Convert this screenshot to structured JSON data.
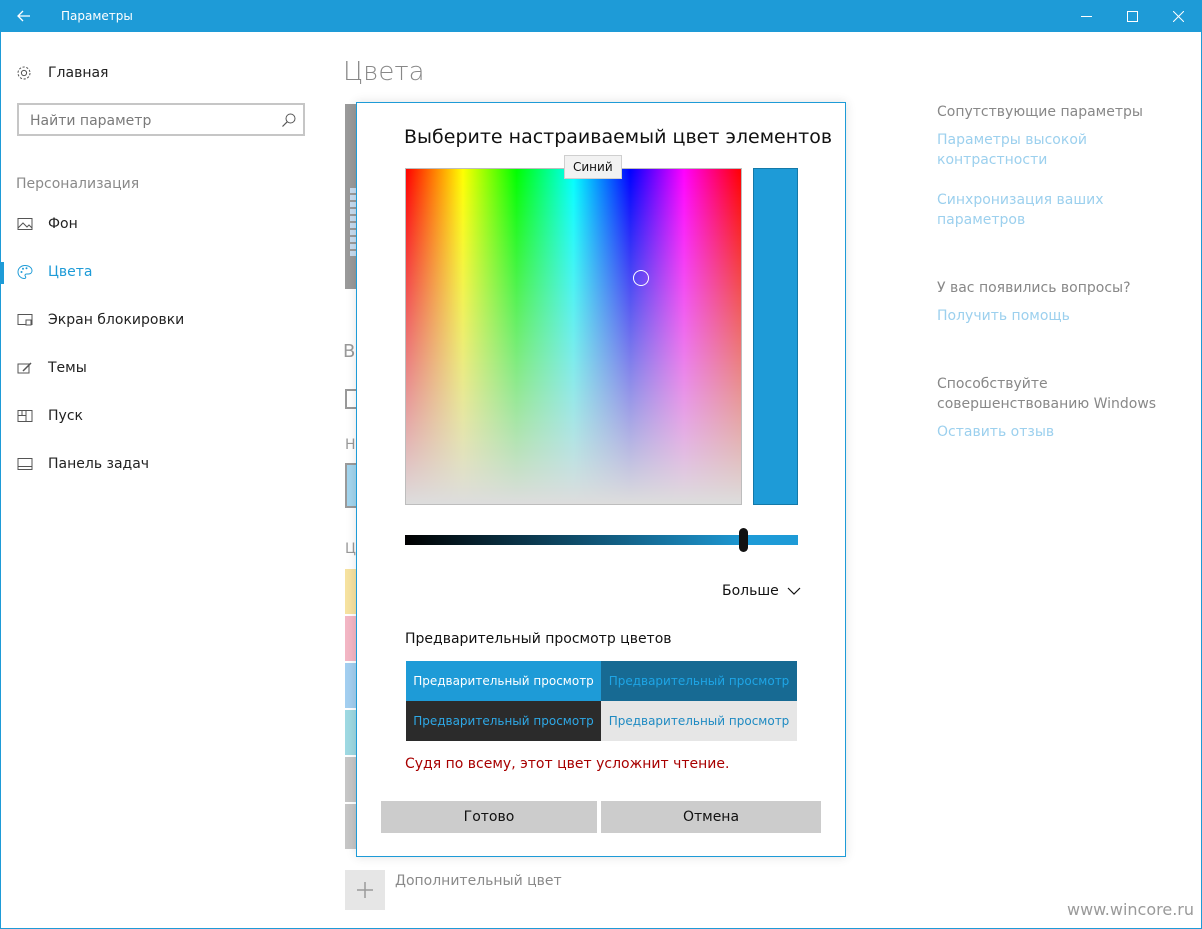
{
  "window": {
    "title": "Параметры"
  },
  "sidebar": {
    "home_label": "Главная",
    "search_placeholder": "Найти параметр",
    "section_label": "Персонализация",
    "items": [
      {
        "label": "Фон",
        "icon": "image-icon"
      },
      {
        "label": "Цвета",
        "icon": "palette-icon",
        "active": true
      },
      {
        "label": "Экран блокировки",
        "icon": "lock-screen-icon"
      },
      {
        "label": "Темы",
        "icon": "themes-icon"
      },
      {
        "label": "Пуск",
        "icon": "start-icon"
      },
      {
        "label": "Панель задач",
        "icon": "taskbar-icon"
      }
    ]
  },
  "main": {
    "page_title": "Цвета",
    "fragments": [
      "В",
      "Н",
      "Ц"
    ],
    "swatch_colors": [
      "#f6e2a0",
      "#f3b6c4",
      "#a3cff0",
      "#9ed9e2",
      "#c6c6c6",
      "#c6c6c6"
    ],
    "add_color_label": "Дополнительный цвет"
  },
  "related": {
    "heading": "Сопутствующие параметры",
    "links": [
      "Параметры высокой контрастности",
      "Синхронизация ваших параметров"
    ],
    "questions_heading": "У вас появились вопросы?",
    "help_link": "Получить помощь",
    "improve_heading": "Способствуйте совершенствованию Windows",
    "feedback_link": "Оставить отзыв"
  },
  "dialog": {
    "title": "Выберите настраиваемый цвет элементов",
    "tooltip": "Синий",
    "selected_color": "#1e9bd7",
    "more_label": "Больше",
    "preview_heading": "Предварительный просмотр цветов",
    "preview_cells": [
      {
        "text": "Предварительный просмотр",
        "bg": "#1e9bd7",
        "fg": "#ffffff"
      },
      {
        "text": "Предварительный просмотр",
        "bg": "#176a93",
        "fg": "#1ea5e6"
      },
      {
        "text": "Предварительный просмотр",
        "bg": "#2b2b2b",
        "fg": "#2ea8e6"
      },
      {
        "text": "Предварительный просмотр",
        "bg": "#e6e6e6",
        "fg": "#1e8ac2"
      }
    ],
    "warning": "Судя по всему, этот цвет усложнит чтение.",
    "done_label": "Готово",
    "cancel_label": "Отмена"
  },
  "watermark": "www.wincore.ru"
}
